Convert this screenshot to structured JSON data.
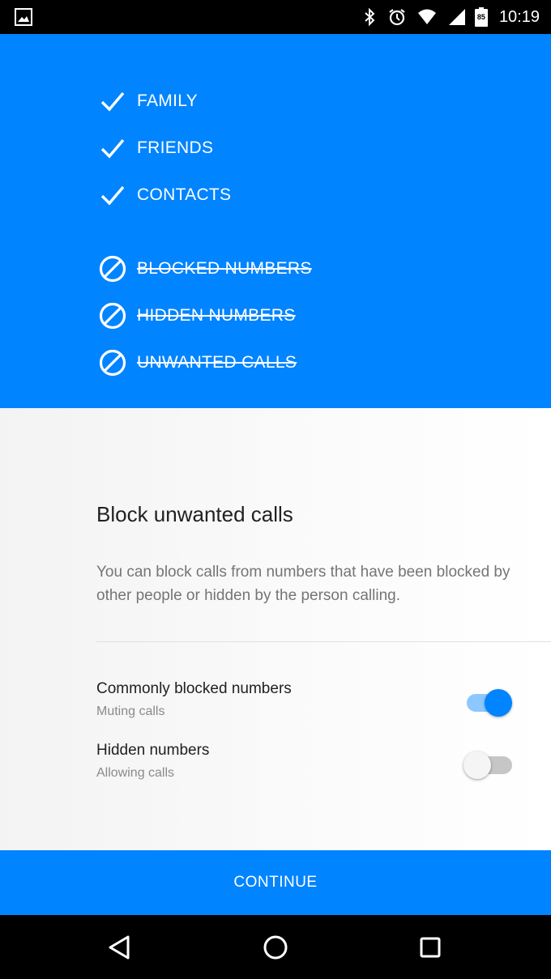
{
  "status_bar": {
    "time": "10:19",
    "battery_level": "85",
    "icons": [
      "image-icon",
      "bluetooth-icon",
      "alarm-icon",
      "wifi-icon",
      "signal-icon",
      "battery-icon"
    ]
  },
  "hero": {
    "allowed": [
      {
        "label": "FAMILY",
        "icon": "check-icon"
      },
      {
        "label": "FRIENDS",
        "icon": "check-icon"
      },
      {
        "label": "CONTACTS",
        "icon": "check-icon"
      }
    ],
    "blocked": [
      {
        "label": "BLOCKED NUMBERS",
        "icon": "block-icon"
      },
      {
        "label": "HIDDEN NUMBERS",
        "icon": "block-icon"
      },
      {
        "label": "UNWANTED CALLS",
        "icon": "block-icon"
      }
    ]
  },
  "content": {
    "title": "Block unwanted calls",
    "description": "You can block calls from numbers that have been blocked by other people or hidden by the person calling.",
    "settings": [
      {
        "title": "Commonly blocked numbers",
        "subtitle": "Muting calls",
        "enabled": true
      },
      {
        "title": "Hidden numbers",
        "subtitle": "Allowing calls",
        "enabled": false
      }
    ]
  },
  "continue_label": "CONTINUE",
  "nav": {
    "buttons": [
      "back-icon",
      "home-icon",
      "recents-icon"
    ]
  },
  "colors": {
    "accent": "#0084ff",
    "accent_light": "#8cc8ff"
  }
}
